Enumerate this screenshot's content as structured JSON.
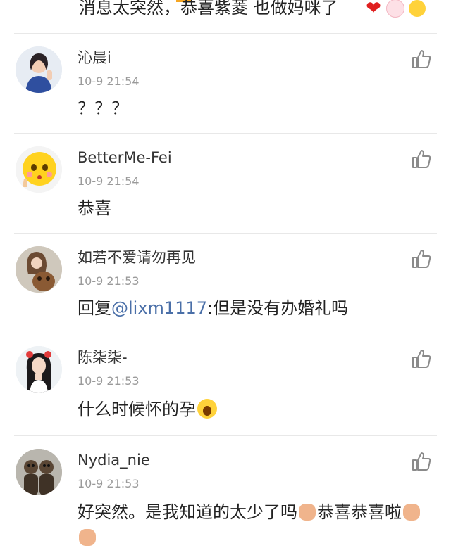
{
  "prev_comment": {
    "text": "消息太突然，恭喜紫菱 也做妈咪了",
    "emoji_icons": [
      "heart-icon",
      "blush-face-icon",
      "tongue-face-icon"
    ]
  },
  "colors": {
    "username": "#333333",
    "timestamp": "#9a9a9a",
    "mention": "#4a6fa8",
    "divider": "#e8e8e8",
    "accent": "#f5a623"
  },
  "comments": [
    {
      "user": "沁晨i",
      "time": "10-9 21:54",
      "text": "？？？",
      "like_icon": "thumbs-up-icon"
    },
    {
      "user": "BetterMe-Fei",
      "time": "10-9 21:54",
      "text": "恭喜",
      "like_icon": "thumbs-up-icon"
    },
    {
      "user": "如若不爱请勿再见",
      "time": "10-9 21:53",
      "reply_prefix": "回复",
      "mention": "@lixm1117",
      "text": ":但是没有办婚礼吗",
      "like_icon": "thumbs-up-icon"
    },
    {
      "user": "陈柒柒-",
      "time": "10-9 21:53",
      "text": "什么时候怀的孕",
      "emoji": "shocked-face-icon",
      "like_icon": "thumbs-up-icon"
    },
    {
      "user": "Nydia_nie",
      "time": "10-9 21:53",
      "text_part1": "好突然。是我知道的太少了吗",
      "text_part2": "恭喜恭喜啦",
      "emoji": "fist-icon",
      "like_icon": "thumbs-up-icon"
    }
  ]
}
